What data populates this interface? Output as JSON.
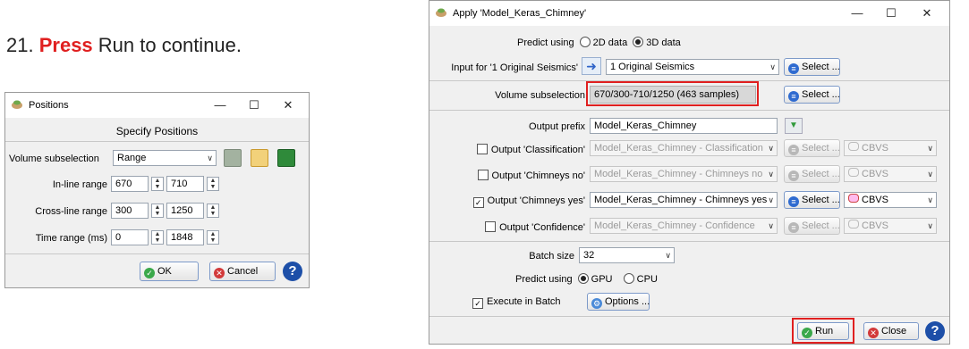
{
  "instruction": {
    "step": "21.",
    "press": "Press",
    "rest": "Run to continue."
  },
  "positions": {
    "title": "Positions",
    "heading": "Specify Positions",
    "volume_label": "Volume subselection",
    "volume_value": "Range",
    "inline_label": "In-line range",
    "inline_from": "670",
    "inline_to": "710",
    "crossline_label": "Cross-line range",
    "crossline_from": "300",
    "crossline_to": "1250",
    "time_label": "Time range (ms)",
    "time_from": "0",
    "time_to": "1848",
    "ok": "OK",
    "cancel": "Cancel"
  },
  "apply": {
    "title": "Apply 'Model_Keras_Chimney'",
    "predict_using_label": "Predict using",
    "opt_2d": "2D data",
    "opt_3d": "3D data",
    "input_label": "Input for '1 Original Seismics'",
    "input_value": "1 Original Seismics",
    "select": "Select ...",
    "volume_label": "Volume subselection",
    "volume_value": "670/300-710/1250 (463 samples)",
    "prefix_label": "Output prefix",
    "prefix_value": "Model_Keras_Chimney",
    "outputs": [
      {
        "label": "Output 'Classification'",
        "value": "Model_Keras_Chimney - Classification",
        "fmt": "CBVS",
        "checked": false
      },
      {
        "label": "Output 'Chimneys no'",
        "value": "Model_Keras_Chimney - Chimneys no",
        "fmt": "CBVS",
        "checked": false
      },
      {
        "label": "Output 'Chimneys yes'",
        "value": "Model_Keras_Chimney - Chimneys yes",
        "fmt": "CBVS",
        "checked": true
      },
      {
        "label": "Output 'Confidence'",
        "value": "Model_Keras_Chimney - Confidence",
        "fmt": "CBVS",
        "checked": false
      }
    ],
    "batch_label": "Batch size",
    "batch_value": "32",
    "device_label": "Predict using",
    "opt_gpu": "GPU",
    "opt_cpu": "CPU",
    "exec_label": "Execute in Batch",
    "options": "Options ...",
    "run": "Run",
    "close": "Close"
  }
}
